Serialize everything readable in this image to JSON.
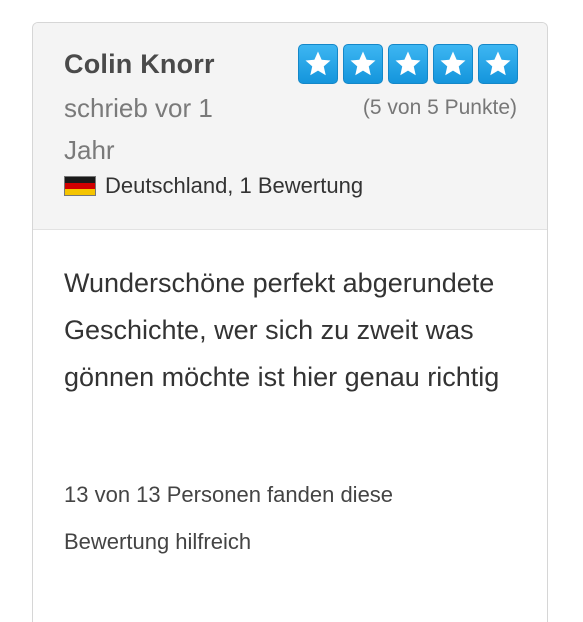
{
  "review": {
    "author": "Colin Knorr",
    "posted": "schrieb vor 1 Jahr",
    "country_icon": "germany-flag-icon",
    "country_text": "Deutschland, 1 Bewertung",
    "rating": {
      "value": 5,
      "max": 5,
      "label": "(5 von 5 Punkte)",
      "star_color": "#1da1e6"
    },
    "text": "Wunderschöne perfekt abgerundete Geschichte, wer sich zu zweit was gönnen möchte ist hier genau richtig",
    "helpful": "13 von 13 Personen fanden diese Bewertung hilfreich"
  }
}
